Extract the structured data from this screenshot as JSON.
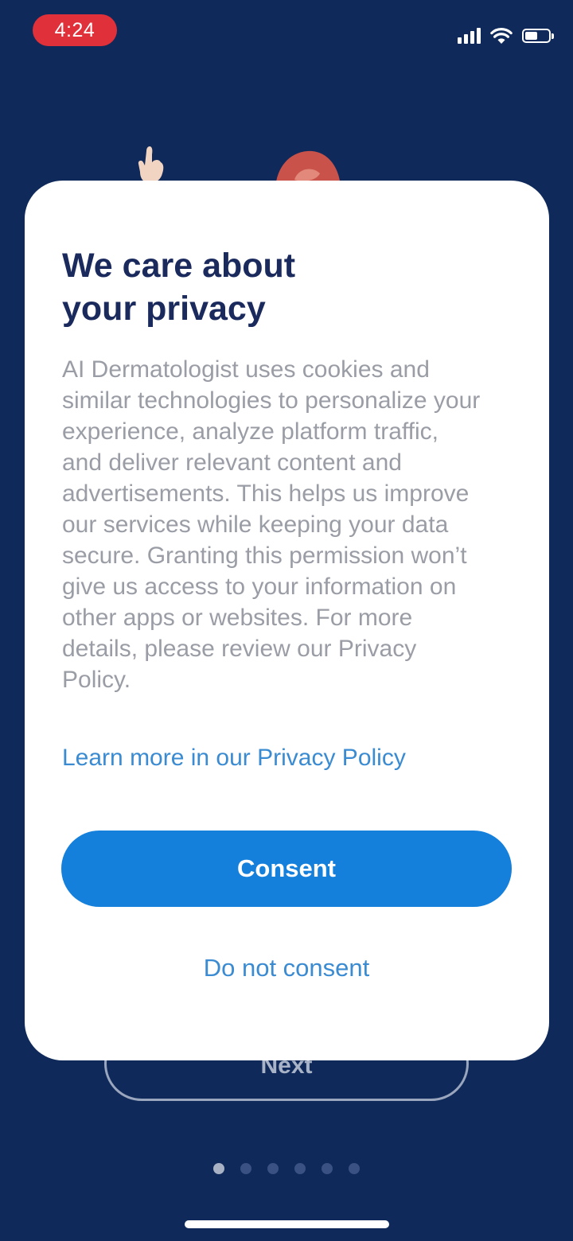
{
  "status_bar": {
    "time": "4:24",
    "icons": [
      "signal-icon",
      "wifi-icon",
      "battery-icon"
    ],
    "battery_level": 0.55
  },
  "onboarding": {
    "next_label": "Next",
    "page_count": 6,
    "active_page": 1
  },
  "modal": {
    "title": "We care about\nyour privacy",
    "body": "AI Dermatologist uses cookies and similar technologies to personalize your experience, analyze platform traffic, and deliver relevant content and advertisements. This helps us improve our services while keeping your data secure. Granting this permission won’t give us access to your information on other apps or websites. For more details, please review our Privacy Policy.",
    "privacy_link": "Learn more in our Privacy Policy",
    "consent_label": "Consent",
    "decline_label": "Do not consent"
  },
  "colors": {
    "background": "#0f2a5a",
    "title": "#1b2a5c",
    "body_text": "#9a9da5",
    "link": "#3a8bd1",
    "primary_button": "#1580db",
    "time_pill": "#e0313a"
  }
}
